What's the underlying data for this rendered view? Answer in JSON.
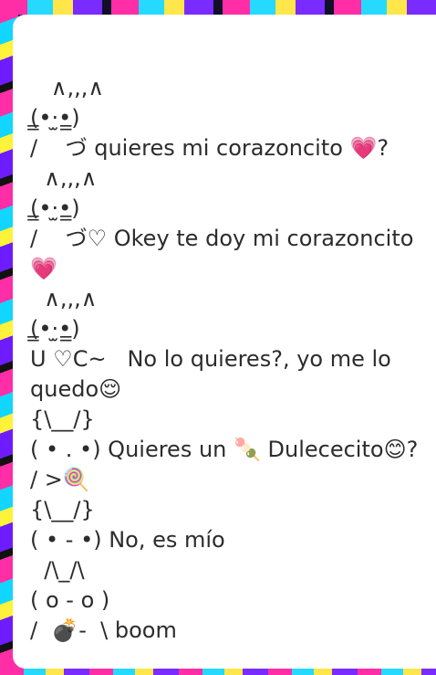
{
  "post": {
    "lines": [
      "   ∧,,,∧",
      "(̳•·̫•̳)",
      "/    づ quieres mi corazoncito 💗?",
      "  ∧,,,∧",
      "(̳•·̫•̳)",
      "/    づ♡ Okey te doy mi corazoncito",
      "💗",
      "  ∧,,,∧",
      "(̳•·̫•̳)",
      "U ♡C~   No lo quieres?, yo me lo",
      "quedo😌",
      "{\\__/}",
      "( • . •) Quieres un 🍡 Dulececito😊?",
      "/ >🍭",
      "{\\__/}",
      "( • - •) No, es mío",
      "  /\\_/\\",
      "( o - o )",
      "/  💣-  \\ boom"
    ]
  },
  "colors": {
    "card_background": "#ffffff",
    "text": "#2c2c2c"
  }
}
